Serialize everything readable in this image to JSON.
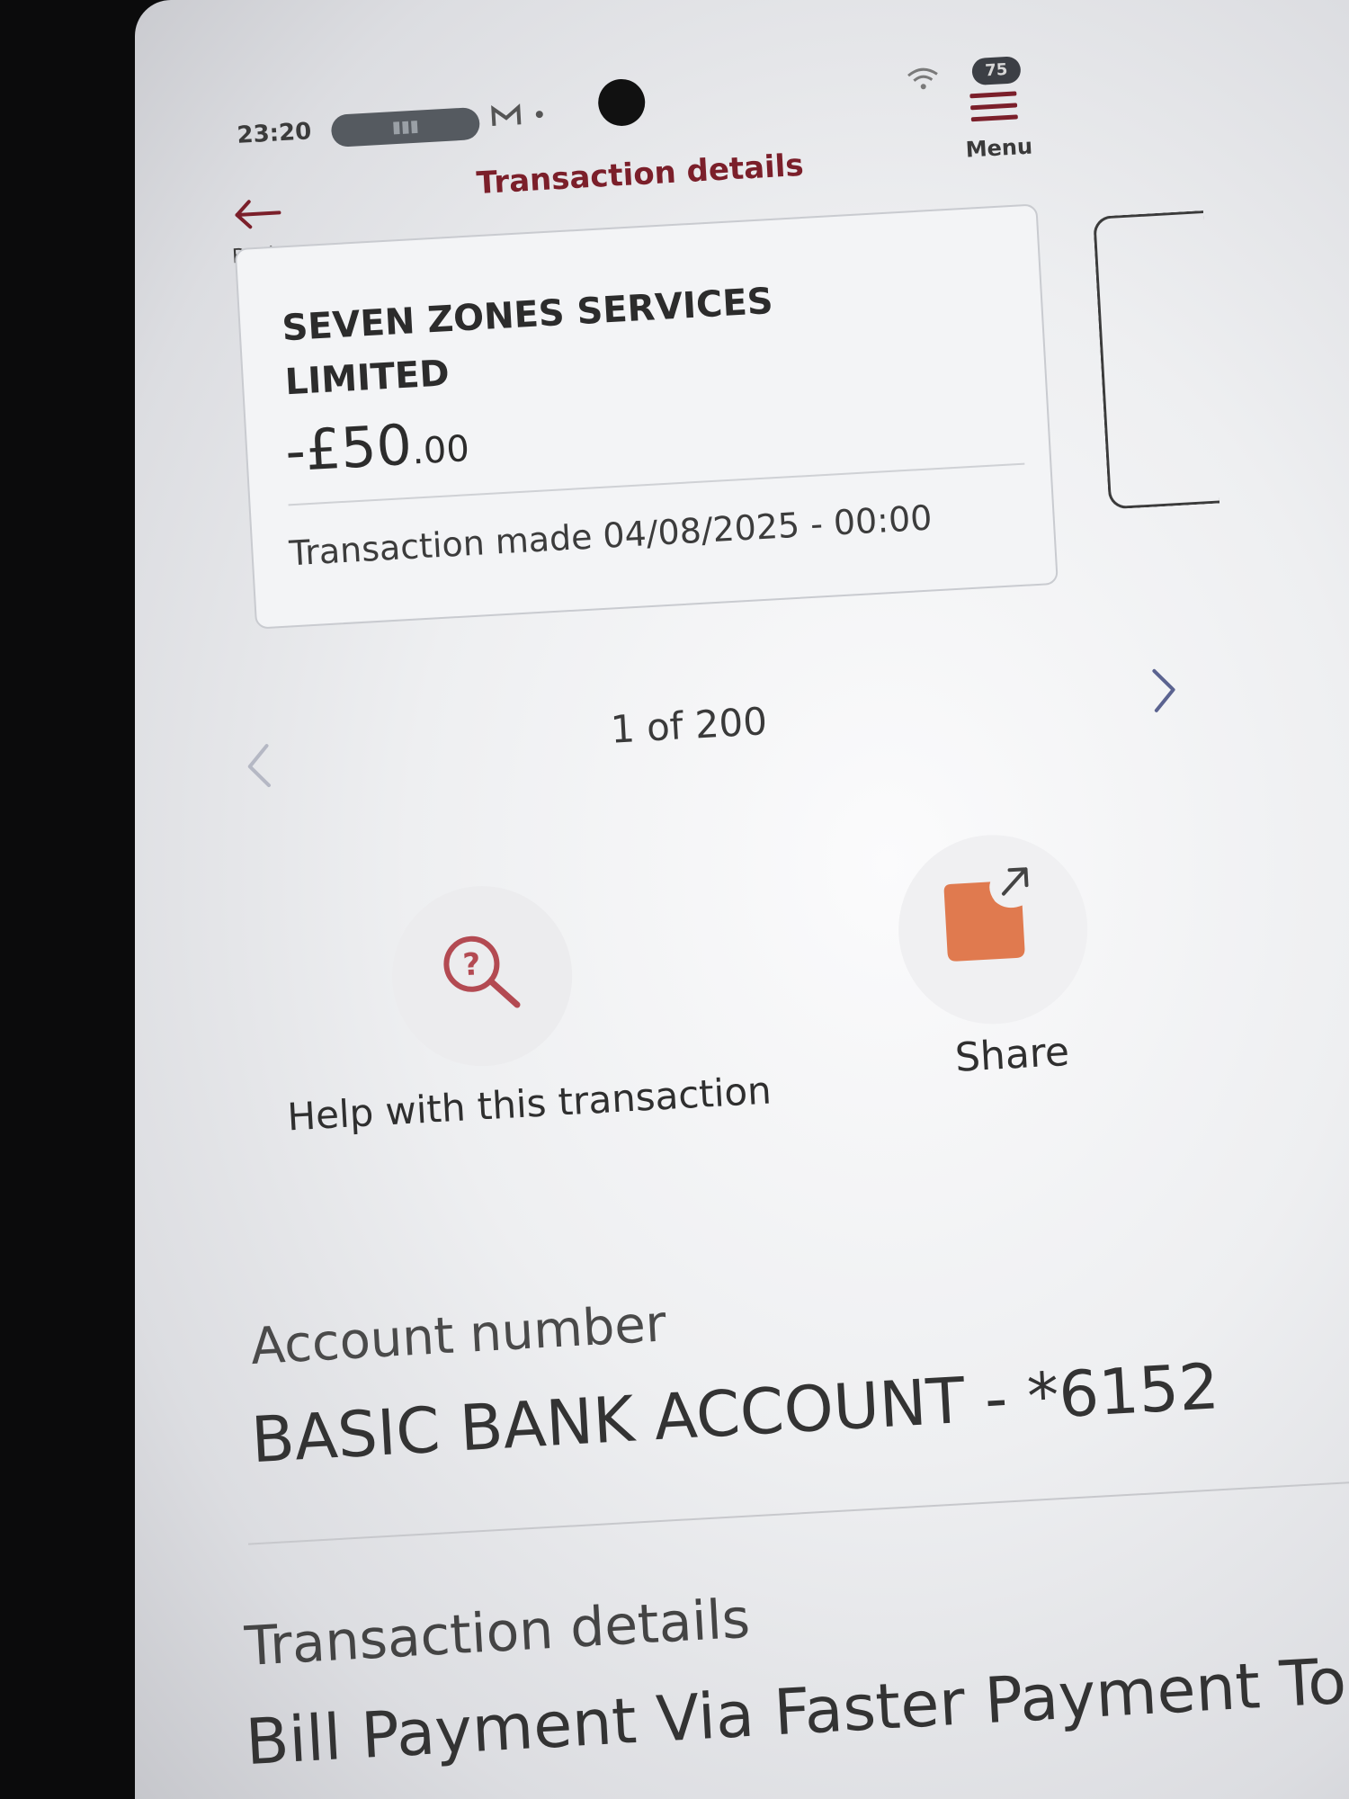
{
  "status_bar": {
    "time": "23:20",
    "battery": "75"
  },
  "header": {
    "back_label": "Back",
    "title": "Transaction details",
    "menu_label": "Menu"
  },
  "transaction": {
    "merchant": "SEVEN ZONES SERVICES LIMITED",
    "amount_main": "-£50",
    "amount_decimal": ".00",
    "made_line": "Transaction made 04/08/2025 - 00:00"
  },
  "pager": {
    "text": "1 of 200"
  },
  "actions": {
    "help_label": "Help with this transaction",
    "share_label": "Share"
  },
  "details": {
    "account_heading": "Account number",
    "account_value": "BASIC BANK ACCOUNT - *6152",
    "transaction_heading": "Transaction details",
    "transaction_value": "Bill Payment Via Faster Payment To"
  },
  "colors": {
    "accent": "#7b1f2a",
    "share_icon": "#e07a4f",
    "help_icon": "#b34a52"
  }
}
